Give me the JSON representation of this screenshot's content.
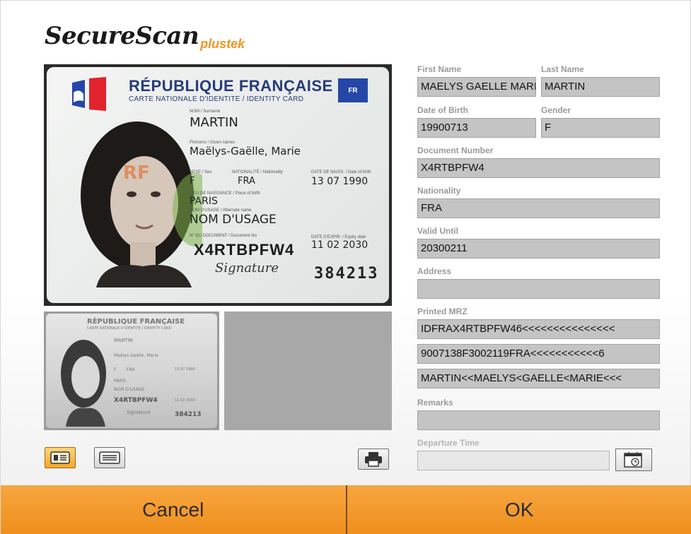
{
  "app": {
    "logo_main": "SecureScan",
    "logo_sub": "plustek"
  },
  "card_front": {
    "title": "RÉPUBLIQUE FRANÇAISE",
    "subtitle": "CARTE NATIONALE D'IDENTITE / IDENTITY CARD",
    "eu_code": "FR",
    "surname_label": "NOM / Surname",
    "surname": "MARTIN",
    "given_label": "Prénoms / Given names",
    "given_names": "Maëlys-Gaëlle, Marie",
    "sex_label": "SEXE / Sex",
    "sex": "F",
    "nationality_label": "NATIONALITÉ / Nationality",
    "nationality": "FRA",
    "dob_label": "DATE DE NAISS. / Date of birth",
    "dob": "13 07 1990",
    "pob_label": "LIEU DE NAISSANCE / Place of birth",
    "pob": "PARIS",
    "usage_label": "NOM D'USAGE / Alternate name",
    "usage_name": "NOM D'USAGE",
    "docno_label": "N° DU DOCUMENT / Document No",
    "doc_number": "X4RTBPFW4",
    "expiry_label": "DATE D'EXPIR. / Expiry date",
    "expiry": "11 02 2030",
    "signature": "Signature",
    "can": "384213"
  },
  "card_back": {
    "title": "RÉPUBLIQUE FRANÇAISE",
    "subtitle": "CARTE NATIONALE D'IDENTITE / IDENTITY CARD",
    "surname": "MARTIN",
    "given_names": "Maëlys-Gaëlle, Marie",
    "sex": "F",
    "nationality": "FRA",
    "dob": "13 07 1990",
    "pob": "PARIS",
    "usage_name": "NOM D'USAGE",
    "doc_number": "X4RTBPFW4",
    "expiry": "11 02 2030",
    "signature": "Signature",
    "can": "384213"
  },
  "form": {
    "first_name_label": "First Name",
    "first_name": "MAELYS GAELLE MARIE",
    "last_name_label": "Last Name",
    "last_name": "MARTIN",
    "dob_label": "Date of Birth",
    "dob": "19900713",
    "gender_label": "Gender",
    "gender": "F",
    "doc_number_label": "Document Number",
    "doc_number": "X4RTBPFW4",
    "nationality_label": "Nationality",
    "nationality": "FRA",
    "valid_until_label": "Valid Until",
    "valid_until": "20300211",
    "address_label": "Address",
    "address": "",
    "mrz_label": "Printed MRZ",
    "mrz_line1": "IDFRAX4RTBPFW46<<<<<<<<<<<<<<<",
    "mrz_line2": "9007138F3002119FRA<<<<<<<<<<<6",
    "mrz_line3": "MARTIN<<MAELYS<GAELLE<MARIE<<<",
    "remarks_label": "Remarks",
    "remarks": "",
    "departure_label": "Departure Time",
    "departure": ""
  },
  "footer": {
    "cancel_label": "Cancel",
    "ok_label": "OK"
  },
  "icons": {
    "id_card_view": "id-card-icon",
    "mrz_view": "mrz-lines-icon",
    "print": "printer-icon",
    "calendar": "calendar-clock-icon"
  },
  "colors": {
    "accent_orange": "#f29422",
    "footer_orange": "#f39c2e",
    "active_button": "#f3a72a",
    "field_gray": "#c4c4c4",
    "label_gray": "#9a9a9a",
    "card_blue": "#273b78"
  }
}
